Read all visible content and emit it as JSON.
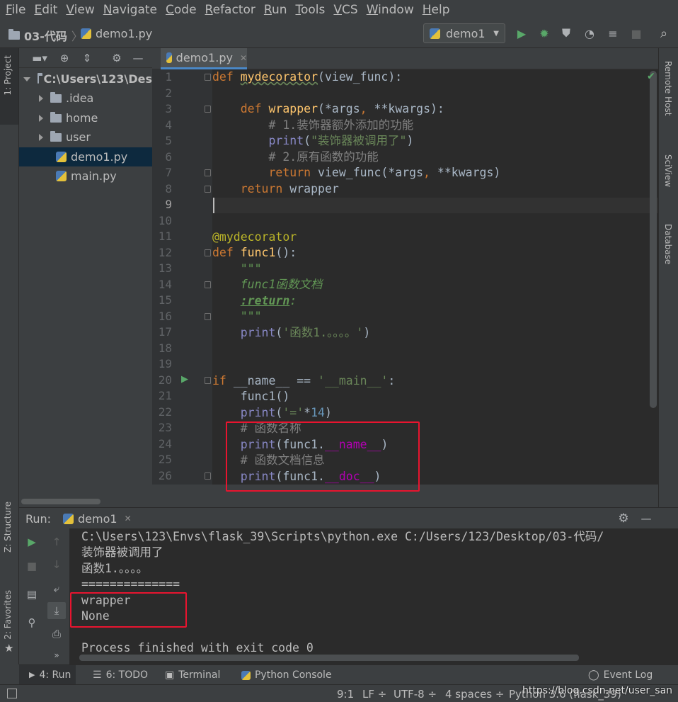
{
  "menu": [
    "File",
    "Edit",
    "View",
    "Navigate",
    "Code",
    "Refactor",
    "Run",
    "Tools",
    "VCS",
    "Window",
    "Help"
  ],
  "breadcrumb": {
    "project": "03-代码",
    "file": "demo1.py"
  },
  "run_config": {
    "label": "demo1"
  },
  "left_strip": {
    "project_tab": "1: Project",
    "structure_tab": "Z: Structure",
    "favorites_tab": "2: Favorites"
  },
  "right_strip": {
    "remote_host": "Remote Host",
    "sciview": "SciView",
    "database": "Database"
  },
  "project_tree": {
    "root": "C:\\Users\\123\\Des",
    "items": [
      {
        "label": ".idea",
        "type": "folder"
      },
      {
        "label": "home",
        "type": "folder"
      },
      {
        "label": "user",
        "type": "folder"
      },
      {
        "label": "demo1.py",
        "type": "file",
        "selected": true
      },
      {
        "label": "main.py",
        "type": "file"
      }
    ]
  },
  "editor": {
    "tab_label": "demo1.py",
    "line_numbers": [
      "1",
      "2",
      "3",
      "4",
      "5",
      "6",
      "7",
      "8",
      "9",
      "10",
      "11",
      "12",
      "13",
      "14",
      "15",
      "16",
      "17",
      "18",
      "19",
      "20",
      "21",
      "22",
      "23",
      "24",
      "25",
      "26"
    ],
    "current_line": "9"
  },
  "run_panel": {
    "title": "Run:",
    "tab_label": "demo1",
    "output": [
      "C:\\Users\\123\\Envs\\flask_39\\Scripts\\python.exe C:/Users/123/Desktop/03-代码/",
      "装饰器被调用了",
      "函数1.。。。。",
      "==============",
      "wrapper",
      "None",
      "",
      "Process finished with exit code 0"
    ]
  },
  "bottom_tabs": {
    "run": "4: Run",
    "todo": "6: TODO",
    "terminal": "Terminal",
    "python_console": "Python Console",
    "event_log": "Event Log"
  },
  "status": {
    "position": "9:1",
    "line_sep": "LF",
    "encoding": "UTF-8",
    "indent": "4 spaces",
    "interpreter": "Python 3.6 (flask_39)",
    "watermark": "https://blog.csdn.net/user_san"
  },
  "colors": {
    "accent_red": "#e8142f",
    "run_green": "#59a869",
    "selection": "#0d293e"
  }
}
